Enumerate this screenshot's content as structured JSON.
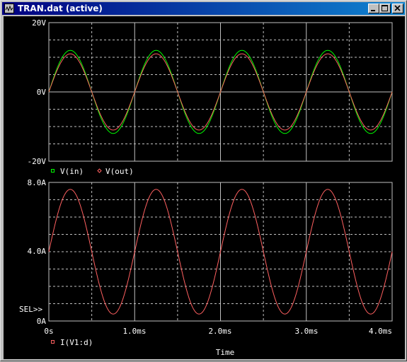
{
  "window": {
    "title": "TRAN.dat (active)",
    "icons": [
      "app-icon",
      "minimize-icon",
      "maximize-icon",
      "close-icon"
    ]
  },
  "colors": {
    "background": "#000000",
    "grid": "#c0c0c0",
    "vin": "#00ff00",
    "vout": "#ff6060",
    "current": "#ff6060",
    "text": "#ffffff"
  },
  "chart_data": [
    {
      "type": "line",
      "ylim": [
        -20,
        20
      ],
      "xlim": [
        0,
        4
      ],
      "y_ticks": [
        "20V",
        "0V",
        "-20V"
      ],
      "y_tick_values": [
        20,
        0,
        -20
      ],
      "legend": [
        {
          "marker": "square",
          "name": "V(in)"
        },
        {
          "marker": "diamond",
          "name": "V(out)"
        }
      ],
      "series": [
        {
          "name": "V(in)",
          "amplitude": 12,
          "frequency_khz": 1,
          "color": "#00ff00"
        },
        {
          "name": "V(out)",
          "amplitude": 11,
          "frequency_khz": 1,
          "color": "#ff6060"
        }
      ],
      "grid": true
    },
    {
      "type": "line",
      "ylim": [
        0,
        8
      ],
      "xlim": [
        0,
        4
      ],
      "y_ticks": [
        "8.0A",
        "4.0A",
        "0A"
      ],
      "y_tick_values": [
        8,
        4,
        0
      ],
      "sel_marker": "SEL>>",
      "legend": [
        {
          "marker": "square",
          "name": "I(V1:d)"
        }
      ],
      "series": [
        {
          "name": "I(V1:d)",
          "offset": 4,
          "amplitude": 3.6,
          "frequency_khz": 1,
          "color": "#ff6060"
        }
      ],
      "x_ticks": [
        "0s",
        "1.0ms",
        "2.0ms",
        "3.0ms",
        "4.0ms"
      ],
      "x_tick_values": [
        0,
        1,
        2,
        3,
        4
      ],
      "xlabel": "Time",
      "grid": true
    }
  ]
}
